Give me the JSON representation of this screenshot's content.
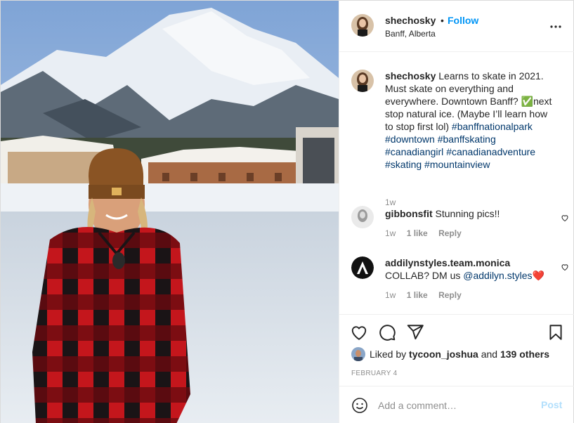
{
  "post": {
    "author": "shechosky",
    "dot": "•",
    "follow_label": "Follow",
    "location": "Banff, Alberta"
  },
  "caption": {
    "username": "shechosky",
    "text_1": " Learns to skate in 2021. Must skate on everything and everywhere. Downtown Banff? ",
    "check_emoji": "✅",
    "text_2": "next stop natural ice. (Maybe I’ll learn how to stop first lol) ",
    "hashtags": [
      "#banffnationalpark",
      "#downtown",
      "#banffskating",
      "#canadiangirl",
      "#canadianadventure",
      "#skating",
      "#mountainview"
    ],
    "time": "1w"
  },
  "comments": [
    {
      "username": "gibbonsfit",
      "text": " Stunning pics!!",
      "time": "1w",
      "likes": "1 like",
      "reply": "Reply"
    },
    {
      "username": "addilynstyles.team.monica",
      "text": "COLLAB? DM us ",
      "mention": "@addilyn.styles",
      "emoji": "❤️",
      "time": "1w",
      "likes": "1 like",
      "reply": "Reply"
    }
  ],
  "likes": {
    "prefix": "Liked by ",
    "user": "tycoon_joshua",
    "middle": " and ",
    "others": "139 others"
  },
  "date": "FEBRUARY 4",
  "add_comment": {
    "placeholder": "Add a comment…",
    "post_label": "Post"
  },
  "icons": {
    "header_more": "more-icon",
    "like": "heart-icon",
    "comment": "comment-icon",
    "share": "share-icon",
    "save": "bookmark-icon",
    "emoji": "emoji-icon",
    "comment_like": "heart-icon"
  },
  "colors": {
    "accent": "#0095f6",
    "link": "#00376b",
    "muted": "#8e8e8e",
    "post_disabled": "#b2dffc"
  }
}
